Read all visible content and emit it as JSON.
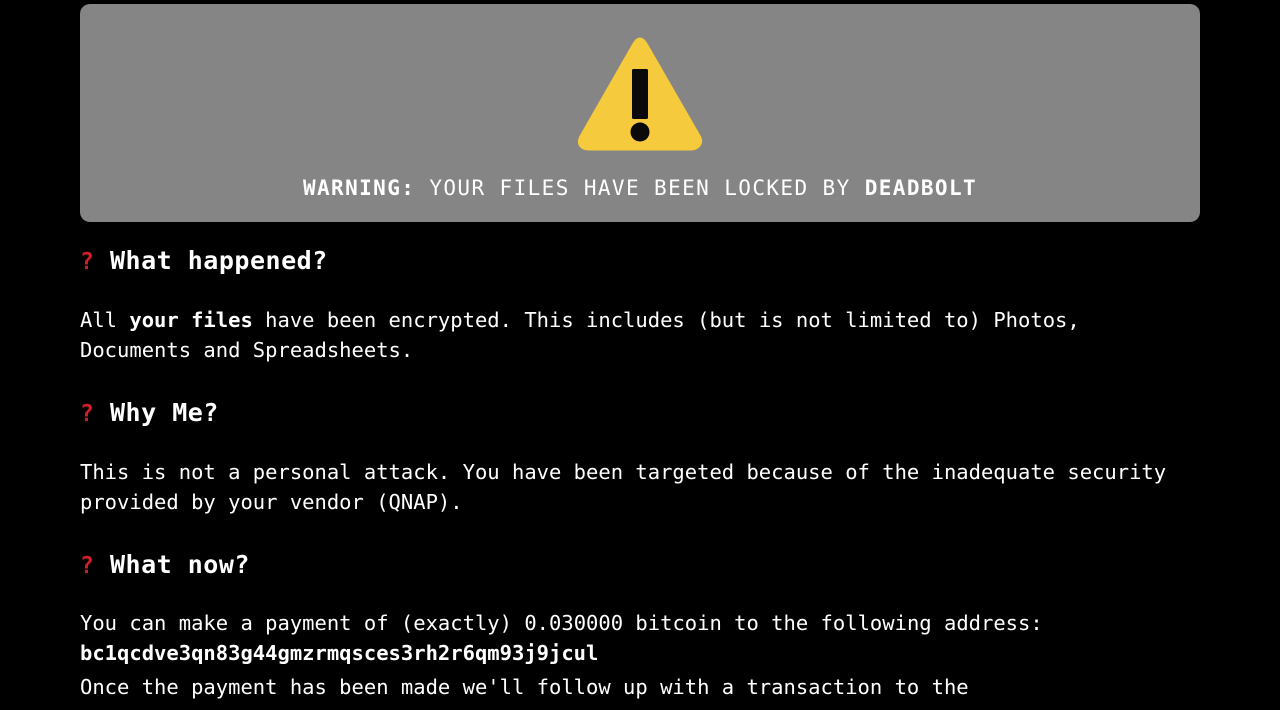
{
  "banner": {
    "icon": "warning-triangle-icon",
    "title_prefix": "WARNING:",
    "title_rest": " YOUR FILES HAVE BEEN LOCKED BY ",
    "title_suffix": "DEADBOLT",
    "background_color": "#858585",
    "icon_color": "#f5ca3c",
    "icon_mark_color": "#000000"
  },
  "colors": {
    "page_background": "#000000",
    "text": "#ffffff",
    "accent_red": "#cc2127"
  },
  "sections": [
    {
      "marker": "?",
      "heading": "What happened?",
      "body_before_bold": "All ",
      "body_bold": "your files",
      "body_after_bold": " have been encrypted. This includes (but is not limited to) Photos, Documents and Spreadsheets."
    },
    {
      "marker": "?",
      "heading": "Why Me?",
      "body": "This is not a personal attack. You have been targeted because of the inadequate security provided by your vendor (QNAP)."
    },
    {
      "marker": "?",
      "heading": "What now?",
      "payment_line_prefix": "You can make a payment of (exactly) ",
      "payment_amount": "0.030000",
      "payment_line_suffix": " bitcoin to the following address:",
      "bitcoin_address": "bc1qcdve3qn83g44gmzrmqsces3rh2r6qm93j9jcul",
      "clipped_line": "Once the payment has been made we'll follow up with a transaction to the"
    }
  ]
}
